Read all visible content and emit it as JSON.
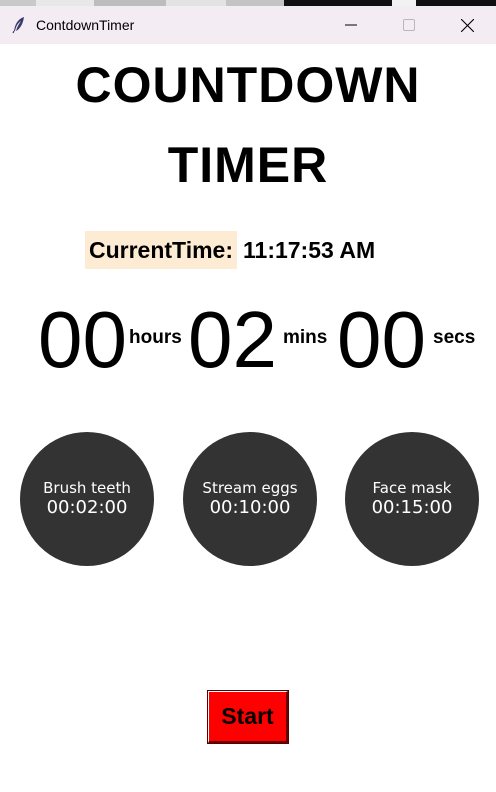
{
  "window": {
    "title": "ContdownTimer",
    "icon": "feather-icon",
    "controls": [
      "minimize-icon",
      "maximize-icon",
      "close-icon"
    ]
  },
  "header": {
    "title_line1": "COUNTDOWN",
    "title_line2": "TIMER"
  },
  "current_time": {
    "label": "CurrentTime:",
    "value": "11:17:53 AM",
    "label_bg": "#fdebd3"
  },
  "countdown": {
    "hours": "00",
    "hours_unit": "hours",
    "mins": "02",
    "mins_unit": "mins",
    "secs": "00",
    "secs_unit": "secs"
  },
  "presets": [
    {
      "name": "Brush teeth",
      "time": "00:02:00"
    },
    {
      "name": "Stream eggs",
      "time": "00:10:00"
    },
    {
      "name": "Face mask",
      "time": "00:15:00"
    }
  ],
  "start_button": {
    "label": "Start",
    "color": "#ff0000"
  },
  "colors": {
    "preset_bg": "#333333",
    "titlebar_bg": "#f3ecf3"
  }
}
